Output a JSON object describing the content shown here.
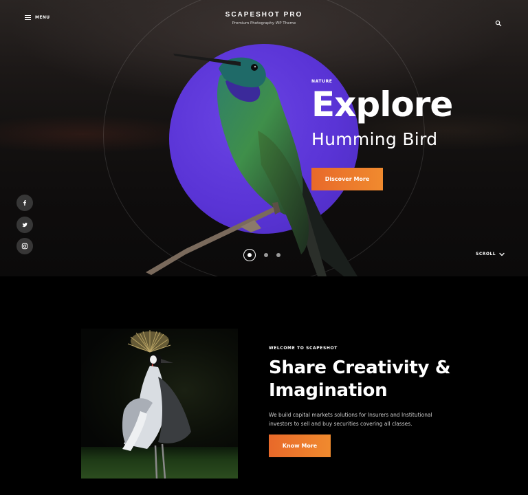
{
  "header": {
    "menu_label": "MENU",
    "brand_title": "SCAPESHOT PRO",
    "brand_subtitle": "Premium Photography WP Theme",
    "icons": [
      "hamburger-icon",
      "search-icon"
    ]
  },
  "hero": {
    "category": "NATURE",
    "title": "Explore",
    "subtitle": "Humming Bird",
    "button_label": "Discover More",
    "slides_total": 3,
    "active_slide": 1,
    "scroll_label": "SCROLL",
    "social_icons": [
      "facebook-icon",
      "twitter-icon",
      "instagram-icon"
    ]
  },
  "welcome": {
    "category": "WELCOME TO SCAPESHOT",
    "title_line1": "Share Creativity &",
    "title_line2": "Imagination",
    "description": "We build capital markets solutions for Insurers and Institutional investors to sell and buy securities covering all classes.",
    "button_label": "Know More"
  },
  "colors": {
    "accent_orange": "#ec7a2c",
    "accent_purple": "#5b36d8",
    "background": "#000000"
  }
}
